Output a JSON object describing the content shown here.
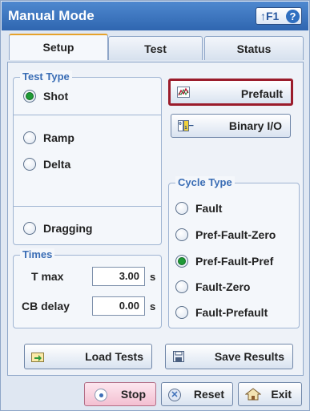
{
  "window": {
    "title": "Manual Mode",
    "help_label": "↑F1"
  },
  "tabs": [
    {
      "label": "Setup",
      "active": true
    },
    {
      "label": "Test",
      "active": false
    },
    {
      "label": "Status",
      "active": false
    }
  ],
  "test_type": {
    "legend": "Test Type",
    "options": [
      "Shot",
      "Ramp",
      "Delta",
      "Dragging"
    ],
    "selected": "Shot"
  },
  "times": {
    "legend": "Times",
    "t_max": {
      "label": "T max",
      "value": "3.00",
      "unit": "s"
    },
    "cb_delay": {
      "label": "CB delay",
      "value": "0.00",
      "unit": "s"
    }
  },
  "actions": {
    "prefault": "Prefault",
    "binary_io": "Binary I/O"
  },
  "cycle_type": {
    "legend": "Cycle Type",
    "options": [
      "Fault",
      "Pref-Fault-Zero",
      "Pref-Fault-Pref",
      "Fault-Zero",
      "Fault-Prefault"
    ],
    "selected": "Pref-Fault-Pref"
  },
  "panel_buttons": {
    "load_tests": "Load Tests",
    "save_results": "Save Results"
  },
  "bottom": {
    "stop": "Stop",
    "reset": "Reset",
    "exit": "Exit"
  },
  "colors": {
    "accent": "#2f66b0",
    "highlight_border": "#9b1c2b",
    "radio_on": "#1f9a36"
  },
  "icons": [
    "prefault-chart-icon",
    "binary-io-icon",
    "load-tests-icon",
    "save-results-icon",
    "stop-icon",
    "reset-icon",
    "home-exit-icon"
  ]
}
